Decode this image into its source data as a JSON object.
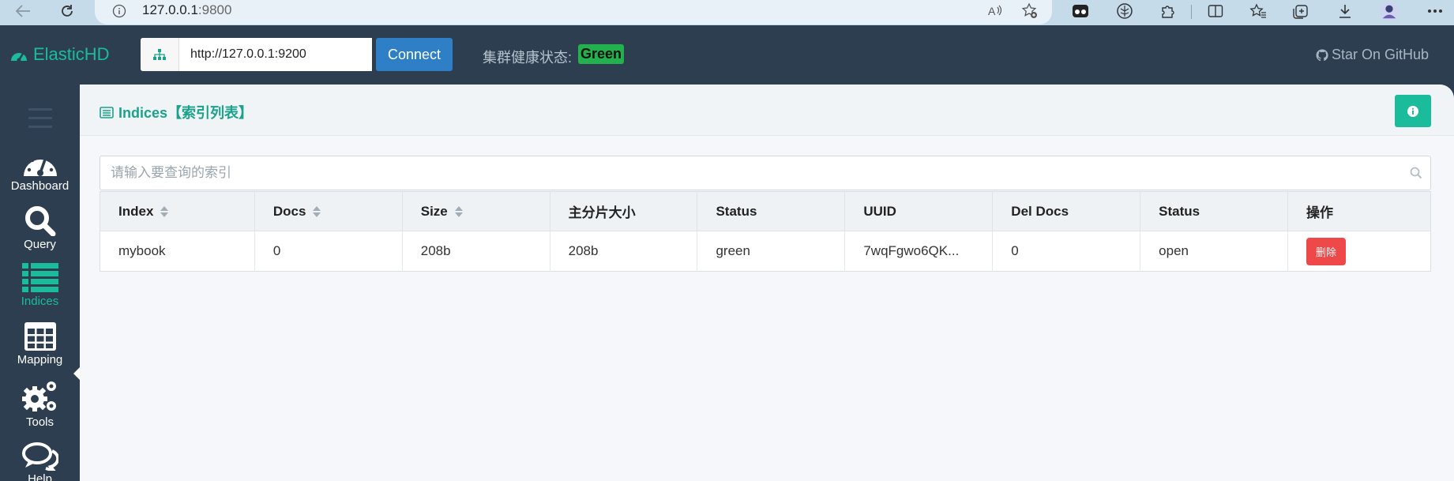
{
  "browser": {
    "url_host": "127.0.0.1",
    "url_port": ":9800"
  },
  "header": {
    "brand": "ElasticHD",
    "server_url": "http://127.0.0.1:9200",
    "connect_label": "Connect",
    "health_label": "集群健康状态:",
    "health_status": "Green",
    "github_label": "Star On GitHub"
  },
  "sidebar": {
    "items": [
      {
        "label": "Dashboard",
        "icon": "dashboard-icon"
      },
      {
        "label": "Query",
        "icon": "search-icon"
      },
      {
        "label": "Indices",
        "icon": "list-icon",
        "active": true
      },
      {
        "label": "Mapping",
        "icon": "table-icon"
      },
      {
        "label": "Tools",
        "icon": "gears-icon"
      },
      {
        "label": "Help",
        "icon": "comments-icon"
      }
    ]
  },
  "panel": {
    "title": "Indices【索引列表】"
  },
  "search": {
    "placeholder": "请输入要查询的索引"
  },
  "table": {
    "headers": [
      "Index",
      "Docs",
      "Size",
      "主分片大小",
      "Status",
      "UUID",
      "Del Docs",
      "Status",
      "操作"
    ],
    "rows": [
      {
        "index": "mybook",
        "docs": "0",
        "size": "208b",
        "primary_size": "208b",
        "health": "green",
        "uuid": "7wqFgwo6QK...",
        "del_docs": "0",
        "status": "open",
        "action": "删除"
      }
    ]
  },
  "colors": {
    "accent": "#1abc9c",
    "header_bg": "#2d3e50",
    "connect_button": "#2e7fc5",
    "health_green": "#23b14d",
    "delete_button": "#ee4848"
  }
}
